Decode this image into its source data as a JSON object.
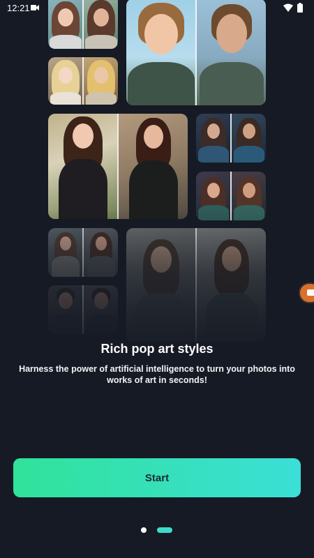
{
  "status_bar": {
    "time": "12:21"
  },
  "onboarding": {
    "title": "Rich pop art styles",
    "description": "Harness the power of artificial intelligence to turn your photos into works of art in seconds!"
  },
  "start_button": {
    "label": "Start"
  },
  "pager": {
    "pages": 2,
    "current_page": 2
  },
  "colors": {
    "background": "#161a25",
    "button_gradient_start": "#30e29a",
    "button_gradient_end": "#3bdfd7",
    "pager_active": "#3fdcc9"
  },
  "icons": [
    "video-camera-icon",
    "wifi-icon",
    "battery-icon",
    "record-video-icon"
  ]
}
